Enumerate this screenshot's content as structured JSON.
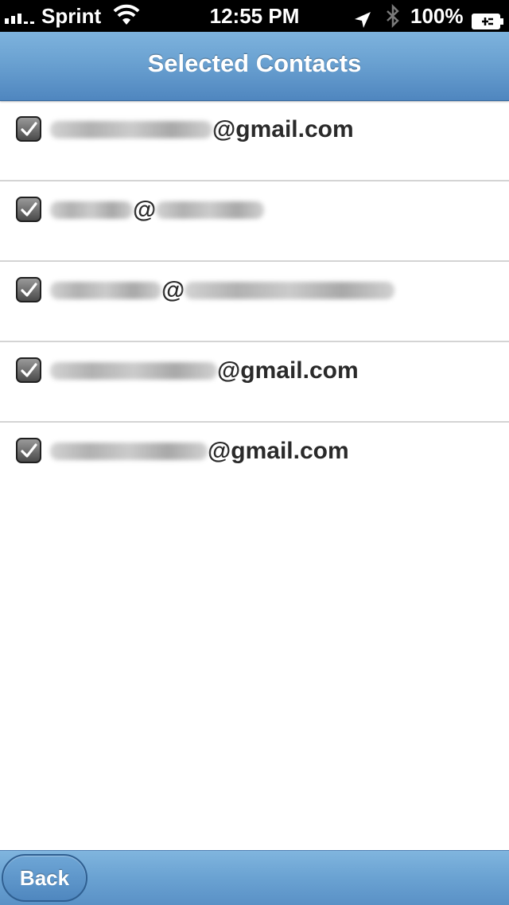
{
  "status_bar": {
    "carrier": "Sprint",
    "time": "12:55 PM",
    "battery_percent": "100%",
    "icons": [
      "signal-bars-icon",
      "wifi-icon",
      "location-arrow-icon",
      "bluetooth-icon",
      "battery-charging-icon"
    ]
  },
  "nav": {
    "title": "Selected Contacts"
  },
  "contacts": [
    {
      "checked": true,
      "at": "@",
      "domain": "gmail.com"
    },
    {
      "checked": true,
      "at": "@",
      "domain": ""
    },
    {
      "checked": true,
      "at": "@",
      "domain": ""
    },
    {
      "checked": true,
      "at": "@",
      "domain": "gmail.com"
    },
    {
      "checked": true,
      "at": "@",
      "domain": "gmail.com"
    }
  ],
  "toolbar": {
    "back_label": "Back"
  },
  "colors": {
    "nav_bar": "#6aa1d1",
    "toolbar": "#6aa2d2",
    "text": "#2a2a2a",
    "divider": "#d4d4d4"
  }
}
